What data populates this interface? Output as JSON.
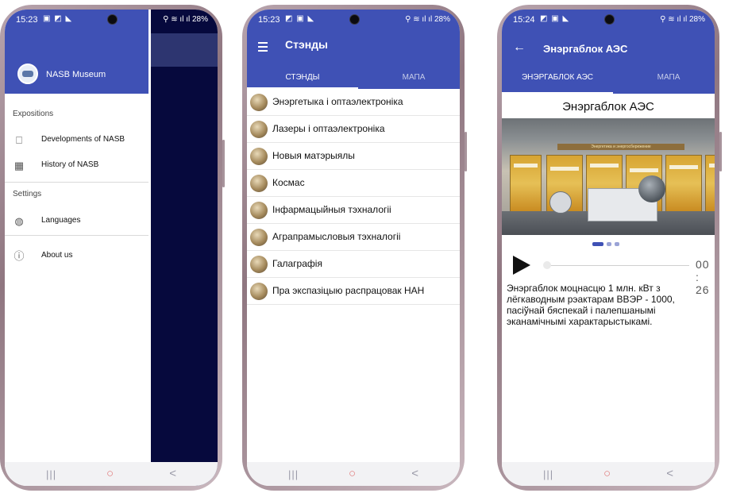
{
  "phones": [
    {
      "status": {
        "time": "15:23",
        "battery": "28%",
        "icons": "▣ ◩ ◣",
        "signal": "⚲ ≋ ıl ıl"
      },
      "drawer": {
        "app_name": "NASB Museum",
        "sections": [
          {
            "title": "Expositions",
            "items": [
              {
                "icon": "bookmark-icon",
                "glyph": "⎕",
                "label": "Developments of NASB"
              },
              {
                "icon": "grid-icon",
                "glyph": "▦",
                "label": "History of NASB"
              }
            ]
          },
          {
            "title": "Settings",
            "items": [
              {
                "icon": "globe-icon",
                "glyph": "◍",
                "label": "Languages"
              }
            ]
          }
        ],
        "about": {
          "icon": "info-icon",
          "glyph": "ⓘ",
          "label": "About us"
        }
      }
    },
    {
      "status": {
        "time": "15:23",
        "battery": "28%",
        "icons": "◩ ▣ ◣",
        "signal": "⚲ ≋ ıl ıl"
      },
      "title": "Стэнды",
      "tabs": [
        {
          "label": "СТЭНДЫ",
          "active": true
        },
        {
          "label": "МАПА",
          "active": false
        }
      ],
      "stands": [
        "Энэргетыка і оптаэлектроніка",
        "Лазеры і оптаэлектроніка",
        "Новыя матэрыялы",
        "Космас",
        "Інфармацыйныя тэхналогіі",
        "Аграпрамысловыя тэхналогіі",
        "Галаграфія",
        "Пра экспазіцыю распрацовак НАН"
      ]
    },
    {
      "status": {
        "time": "15:24",
        "battery": "28%",
        "icons": "◩ ▣ ◣",
        "signal": "⚲ ≋ ıl ıl"
      },
      "title": "Энэргаблок АЭС",
      "tabs": [
        {
          "label": "ЭНЭРГАБЛОК АЭС",
          "active": true
        },
        {
          "label": "МАПА",
          "active": false
        }
      ],
      "heading": "Энэргаблок АЭС",
      "photo_banner": "Энергетика и энергосбережение",
      "carousel": {
        "count": 3,
        "active": 0
      },
      "player": {
        "time": "00 : 26",
        "progress": 0.0
      },
      "description": "Энэргаблок моцнасцю 1 млн. кВт з лёгкаводным рэактарам ВВЭР - 1000, пасіўнай бяспекай і палепшанымі эканамічнымі характарыстыкамі."
    }
  ],
  "navbar": {
    "recent": "|||",
    "home": "○",
    "back": "<"
  },
  "colors": {
    "primary": "#3f51b5",
    "scrim": "#06093d",
    "frame": "#9e8790",
    "carousel_active": "#3f51b5",
    "carousel_inactive": "#9aa3d6"
  }
}
